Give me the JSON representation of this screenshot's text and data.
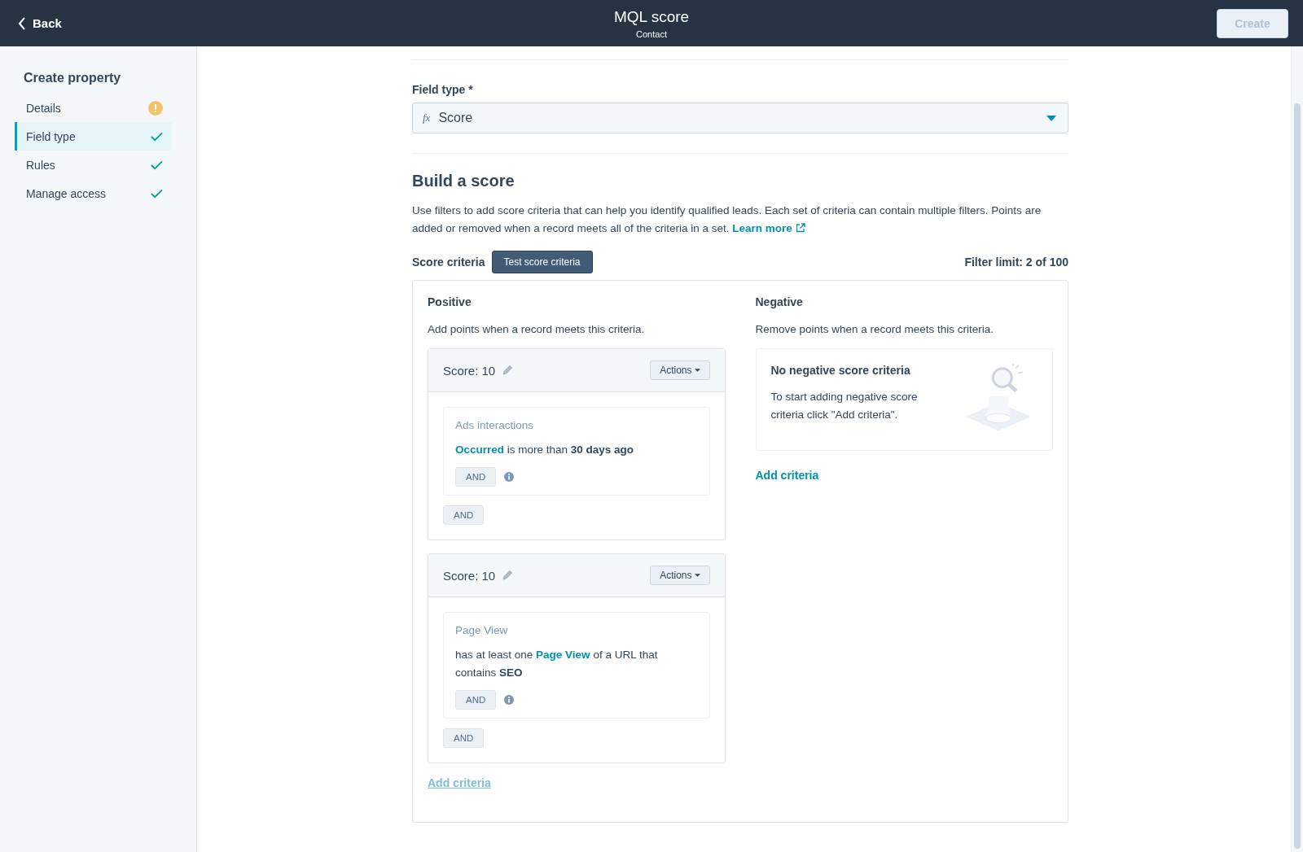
{
  "header": {
    "back": "Back",
    "title": "MQL score",
    "subtitle": "Contact",
    "create_button": {
      "label": "Create",
      "disabled": true
    }
  },
  "sidebar": {
    "title": "Create property",
    "items": [
      {
        "label": "Details",
        "selected": false,
        "complete": false
      },
      {
        "label": "Field type",
        "selected": true,
        "complete": true
      },
      {
        "label": "Rules",
        "selected": false,
        "complete": true
      },
      {
        "label": "Manage access",
        "selected": false,
        "complete": true
      }
    ]
  },
  "field_type": {
    "label": "Field type *",
    "prefix": "fx",
    "value": "Score"
  },
  "build": {
    "title": "Build a score",
    "description": "Use filters to add score criteria that can help you identify qualified leads. Each set of criteria can contain multiple filters. Points are added or removed when a record meets all of the criteria in a set.",
    "learn_more": "Learn more",
    "criteria_label": "Score criteria",
    "test_button": "Test score criteria",
    "filter_limit": "Filter limit: 2 of 100"
  },
  "positive": {
    "title": "Positive",
    "description": "Add points when a record meets this criteria.",
    "groups": [
      {
        "score": "Score: 10",
        "actions": "Actions",
        "filter": {
          "name": "Ads interactions",
          "parts": [
            {
              "text": "Occurred",
              "kind": "link"
            },
            {
              "text": " is more than ",
              "kind": "plain"
            },
            {
              "text": "30 days ago",
              "kind": "bold"
            }
          ]
        },
        "inner_and": "AND",
        "outer_and": "AND"
      },
      {
        "score": "Score: 10",
        "actions": "Actions",
        "filter": {
          "name": "Page View",
          "parts": [
            {
              "text": "has at least one ",
              "kind": "plain"
            },
            {
              "text": "Page View",
              "kind": "link"
            },
            {
              "text": " of a URL that contains ",
              "kind": "plain"
            },
            {
              "text": "SEO",
              "kind": "bold"
            }
          ]
        },
        "inner_and": "AND",
        "outer_and": "AND"
      }
    ],
    "add_criteria": "Add criteria"
  },
  "negative": {
    "title": "Negative",
    "description": "Remove points when a record meets this criteria.",
    "empty_title": "No negative score criteria",
    "empty_text": "To start adding negative score criteria click \"Add criteria\".",
    "add_criteria": "Add criteria"
  }
}
